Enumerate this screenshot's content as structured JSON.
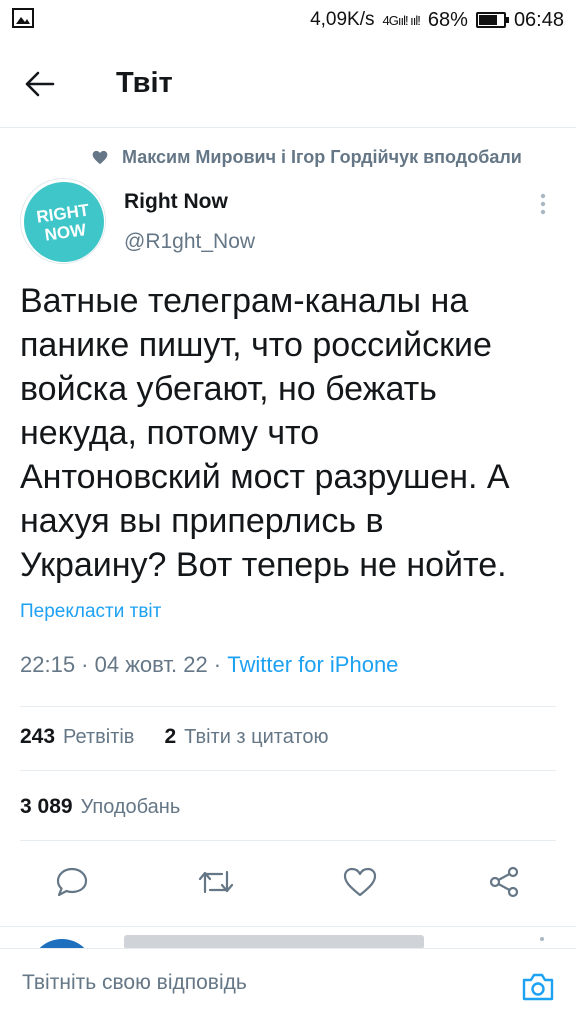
{
  "status_bar": {
    "speed": "4,09K/s",
    "signal": "4Gııl! ııl!",
    "battery_percent": "68%",
    "battery_level": 0.68,
    "time": "06:48"
  },
  "header": {
    "title": "Твіт"
  },
  "social_context": {
    "text": "Максим Мирович і Ігор Гордійчук вподобали"
  },
  "tweet": {
    "author_name": "Right Now",
    "author_handle": "@R1ght_Now",
    "avatar_logo_text": "RIGHT NOW",
    "text_lines": [
      "Ватные телеграм-каналы на",
      "панике пишут, что российские",
      "войска убегают, но бежать",
      "некуда, потому что",
      "Антоновский мост разрушен. А",
      "нахуя вы приперлись в",
      "Украину? Вот теперь не нойте."
    ],
    "translate_label": "Перекласти твіт",
    "timestamp": "22:15 · 04 жовт. 22 · ",
    "source": "Twitter for iPhone"
  },
  "stats": {
    "retweets_count": "243",
    "retweets_label": "Ретвітів",
    "quotes_count": "2",
    "quotes_label": "Твіти з цитатою",
    "likes_count": "3 089",
    "likes_label": "Уподобань"
  },
  "actions": {
    "reply_icon": "reply-icon",
    "retweet_icon": "retweet-icon",
    "like_icon": "heart-icon",
    "share_icon": "share-icon"
  },
  "reply_bar": {
    "placeholder": "Твітніть свою відповідь"
  },
  "colors": {
    "accent": "#1da1f2",
    "secondary_text": "#657786",
    "avatar_brand": "#3ec6c9",
    "border": "#e6ecf0"
  }
}
